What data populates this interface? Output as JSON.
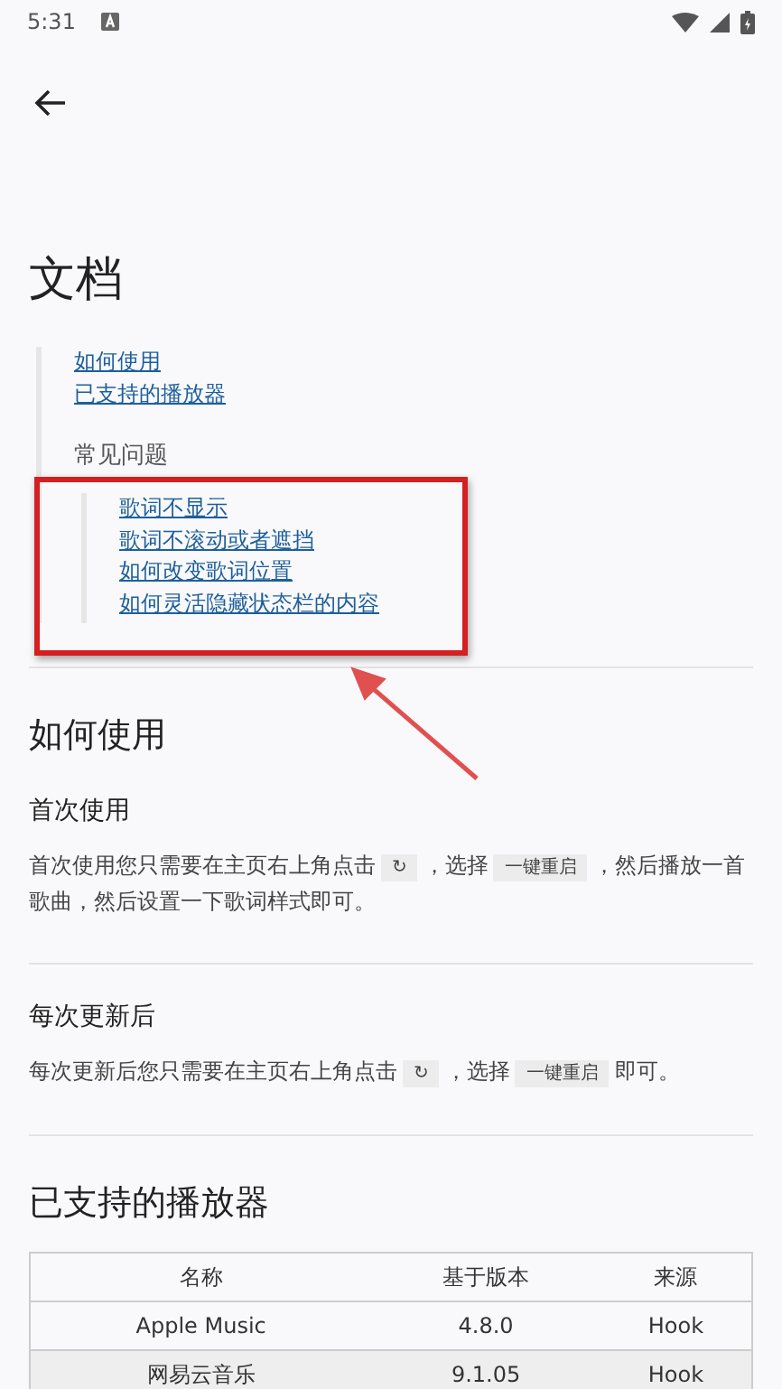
{
  "status_bar": {
    "time": "5:31"
  },
  "page": {
    "title": "文档"
  },
  "toc": {
    "links": [
      {
        "label": "如何使用"
      },
      {
        "label": "已支持的播放器"
      }
    ],
    "group_title": "常见问题",
    "sub_links": [
      {
        "label": "歌词不显示"
      },
      {
        "label": "歌词不滚动或者遮挡"
      },
      {
        "label": "如何改变歌词位置"
      },
      {
        "label": "如何灵活隐藏状态栏的内容"
      }
    ]
  },
  "annotation": {
    "kind": "box-with-arrow"
  },
  "sections": [
    {
      "kind": "heading",
      "text": "如何使用"
    },
    {
      "kind": "subheading",
      "text": "首次使用"
    },
    {
      "kind": "paragraph",
      "parts": [
        {
          "kind": "text",
          "text": "首次使用您只需要在主页右上角点击"
        },
        {
          "kind": "code",
          "text": "↻"
        },
        {
          "kind": "text",
          "text": "，选择"
        },
        {
          "kind": "code",
          "text": "一键重启"
        },
        {
          "kind": "text",
          "text": "，然后播放一首歌曲，然后设置一下歌词样式即可。"
        }
      ]
    },
    {
      "kind": "divider"
    },
    {
      "kind": "subheading",
      "text": "每次更新后"
    },
    {
      "kind": "paragraph",
      "parts": [
        {
          "kind": "text",
          "text": "每次更新后您只需要在主页右上角点击"
        },
        {
          "kind": "code",
          "text": "↻"
        },
        {
          "kind": "text",
          "text": "，选择"
        },
        {
          "kind": "code",
          "text": "一键重启"
        },
        {
          "kind": "text",
          "text": "即可。"
        }
      ]
    },
    {
      "kind": "divider"
    },
    {
      "kind": "heading",
      "text": "已支持的播放器"
    }
  ],
  "table": {
    "columns": [
      "名称",
      "基于版本",
      "来源"
    ],
    "rows": [
      [
        "Apple Music",
        "4.8.0",
        "Hook"
      ],
      [
        "网易云音乐",
        "9.1.05",
        "Hook"
      ]
    ]
  }
}
